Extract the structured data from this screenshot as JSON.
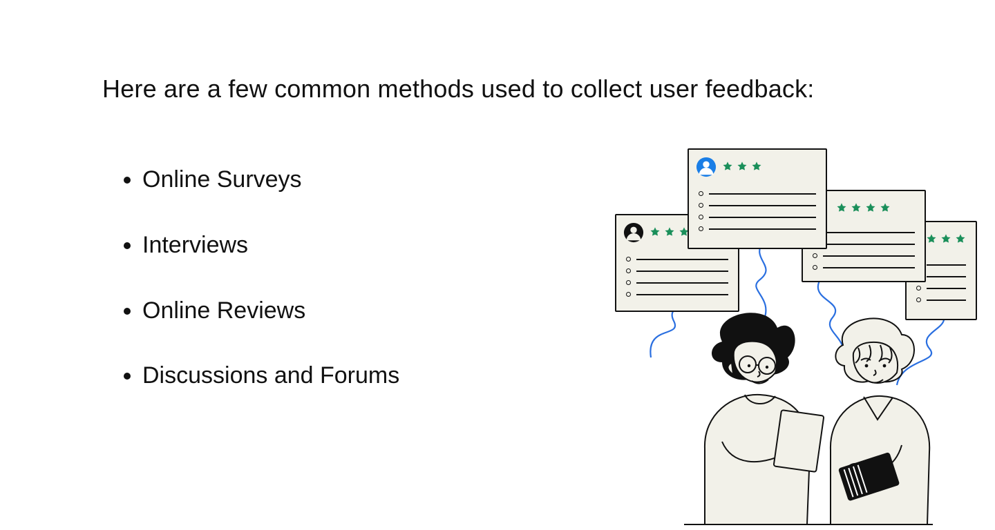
{
  "heading": "Here are a few common methods used to collect user feedback:",
  "bullets": [
    "Online Surveys",
    "Interviews",
    "Online Reviews",
    "Discussions and Forums"
  ],
  "illustration": {
    "description": "Two people reading reviews surrounded by floating review cards with star ratings",
    "cards": [
      {
        "avatar_color": "blue",
        "stars": 3
      },
      {
        "avatar_color": "black",
        "stars": 3
      },
      {
        "avatar_color": "none",
        "stars": 4
      },
      {
        "avatar_color": "none",
        "stars": 3
      }
    ],
    "colors": {
      "star": "#1a8f5a",
      "avatar_blue": "#1a7ee6",
      "swirl": "#2a6fe0",
      "card_bg": "#f2f1e9",
      "ink": "#111111"
    }
  }
}
